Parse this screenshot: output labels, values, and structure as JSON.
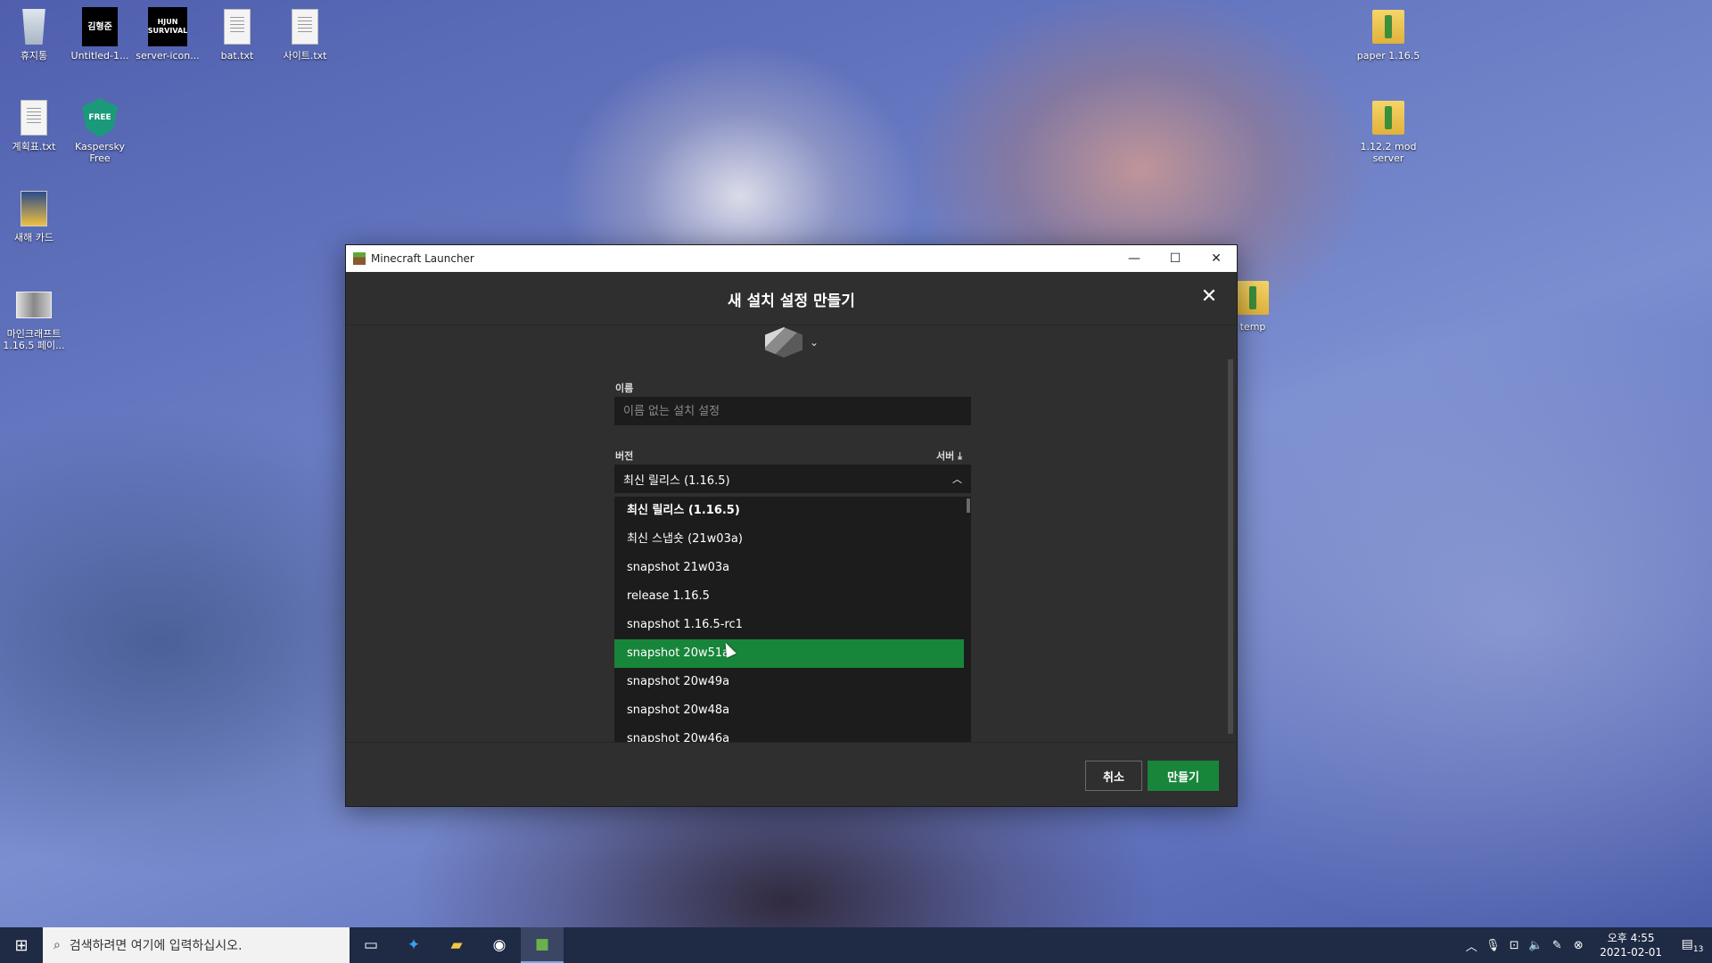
{
  "desktop": {
    "icons": [
      {
        "label": "휴지통",
        "icon": "recycle-bin-icon"
      },
      {
        "label": "Untitled-1...",
        "icon": "image-file-icon",
        "tile_text": "김형준"
      },
      {
        "label": "server-icon...",
        "icon": "image-file-icon",
        "tile_text": "HJUN SURVIVAL"
      },
      {
        "label": "bat.txt",
        "icon": "text-file-icon"
      },
      {
        "label": "사이트.txt",
        "icon": "text-file-icon"
      },
      {
        "label": "계획표.txt",
        "icon": "text-file-icon"
      },
      {
        "label": "Kaspersky Free",
        "icon": "kaspersky-shield-icon",
        "tile_text": "FREE"
      },
      {
        "label": "새해 카드",
        "icon": "card-file-icon"
      },
      {
        "label": "마인크래프트 1.16.5 페이...",
        "icon": "image-file-icon"
      },
      {
        "label": "paper 1.16.5",
        "icon": "zip-folder-icon"
      },
      {
        "label": "1.12.2 mod server",
        "icon": "zip-folder-icon"
      },
      {
        "label": "temp",
        "icon": "zip-folder-icon"
      }
    ]
  },
  "window": {
    "title": "Minecraft Launcher",
    "controls": {
      "minimize": "—",
      "maximize": "☐",
      "close": "✕"
    }
  },
  "dialog": {
    "title": "새 설치 설정 만들기",
    "close": "✕",
    "name_label": "이름",
    "name_placeholder": "이름 없는 설치 설정",
    "name_value": "",
    "version_label": "버전",
    "server_link": "서버 ⤓",
    "selected_version": "최신 릴리스 (1.16.5)",
    "versions": [
      "최신 릴리스 (1.16.5)",
      "최신 스냅숏 (21w03a)",
      "snapshot 21w03a",
      "release 1.16.5",
      "snapshot 1.16.5-rc1",
      "snapshot 20w51a",
      "snapshot 20w49a",
      "snapshot 20w48a",
      "snapshot 20w46a"
    ],
    "highlighted_index": 5,
    "cancel_label": "취소",
    "create_label": "만들기"
  },
  "taskbar": {
    "search_placeholder": "검색하려면 여기에 입력하십시오.",
    "clock_time": "오후 4:55",
    "clock_date": "2021-02-01",
    "notification_count": "13"
  },
  "colors": {
    "accent": "#18863a",
    "dialog_bg": "#2f2f2f",
    "field_bg": "#1c1c1c"
  }
}
